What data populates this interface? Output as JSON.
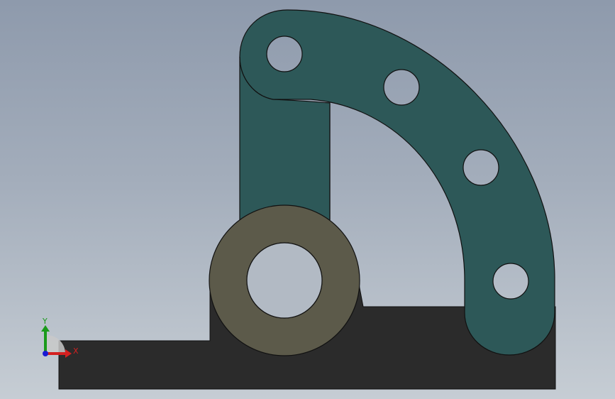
{
  "viewport": {
    "background_top": "#8e9aac",
    "background_bottom": "#c6cdd4"
  },
  "model": {
    "base_color": "#2b2b2b",
    "arm_color": "#2d5858",
    "bushing_color": "#5c5a4a",
    "edge_color": "#111111",
    "hole_count_arm": 4
  },
  "triad": {
    "x_label": "X",
    "y_label": "Y",
    "x_color": "#d42020",
    "y_color": "#1a9a1a",
    "z_color": "#1a1ad4"
  }
}
